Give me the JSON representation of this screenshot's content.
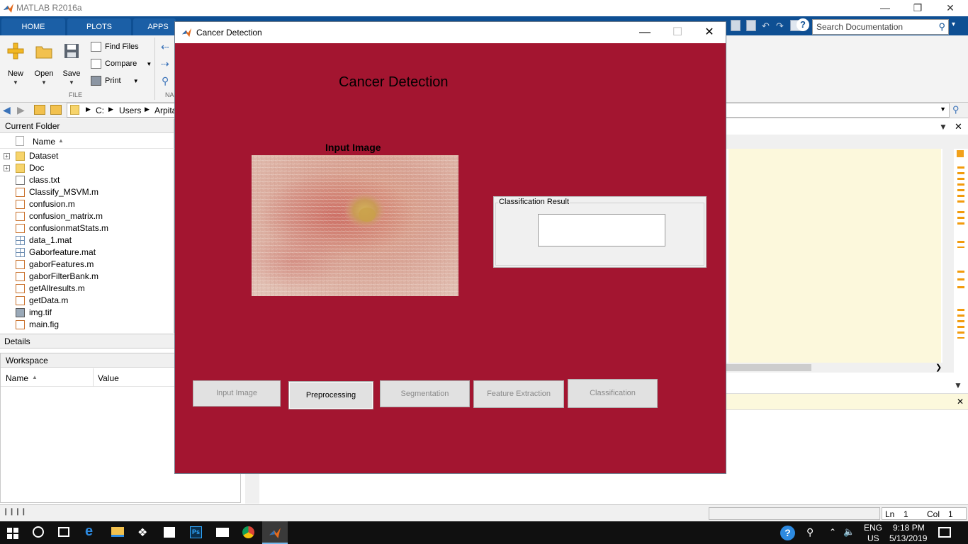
{
  "app": {
    "title": "MATLAB R2016a",
    "ribbon_tabs": [
      "HOME",
      "PLOTS",
      "APPS"
    ],
    "search_placeholder": "Search Documentation",
    "file_group": {
      "label": "FILE",
      "new_label": "New",
      "open_label": "Open",
      "save_label": "Save",
      "find_files_label": "Find Files",
      "compare_label": "Compare",
      "print_label": "Print"
    },
    "partial_group_label": "NA",
    "address": {
      "crumbs": [
        "C:",
        "Users",
        "Arpita"
      ]
    }
  },
  "current_folder": {
    "title": "Current Folder",
    "column_name": "Name",
    "items": [
      {
        "name": "Dataset",
        "type": "folder"
      },
      {
        "name": "Doc",
        "type": "folder"
      },
      {
        "name": "class.txt",
        "type": "txt"
      },
      {
        "name": "Classify_MSVM.m",
        "type": "m"
      },
      {
        "name": "confusion.m",
        "type": "m"
      },
      {
        "name": "confusion_matrix.m",
        "type": "m"
      },
      {
        "name": "confusionmatStats.m",
        "type": "m"
      },
      {
        "name": "data_1.mat",
        "type": "mat"
      },
      {
        "name": "Gaborfeature.mat",
        "type": "mat"
      },
      {
        "name": "gaborFeatures.m",
        "type": "m"
      },
      {
        "name": "gaborFilterBank.m",
        "type": "m"
      },
      {
        "name": "getAllresults.m",
        "type": "m"
      },
      {
        "name": "getData.m",
        "type": "m"
      },
      {
        "name": "img.tif",
        "type": "img"
      },
      {
        "name": "main.fig",
        "type": "fig"
      }
    ]
  },
  "details": {
    "title": "Details"
  },
  "workspace": {
    "title": "Workspace",
    "columns": [
      "Name",
      "Value"
    ]
  },
  "status": {
    "ln_label": "Ln",
    "ln_value": "1",
    "col_label": "Col",
    "col_value": "1"
  },
  "figure": {
    "window_title": "Cancer Detection",
    "heading": "Cancer Detection",
    "input_image_label": "Input Image",
    "result_panel_title": "Classification Result",
    "result_value": "",
    "buttons": [
      {
        "label": "Input Image",
        "enabled": false
      },
      {
        "label": "Preprocessing",
        "enabled": true
      },
      {
        "label": "Segmentation",
        "enabled": false
      },
      {
        "label": "Feature Extraction",
        "enabled": false
      },
      {
        "label": "Classification",
        "enabled": false
      }
    ],
    "background_color": "#a31530"
  },
  "taskbar": {
    "lang_top": "ENG",
    "lang_bottom": "US",
    "time": "9:18 PM",
    "date": "5/13/2019"
  }
}
